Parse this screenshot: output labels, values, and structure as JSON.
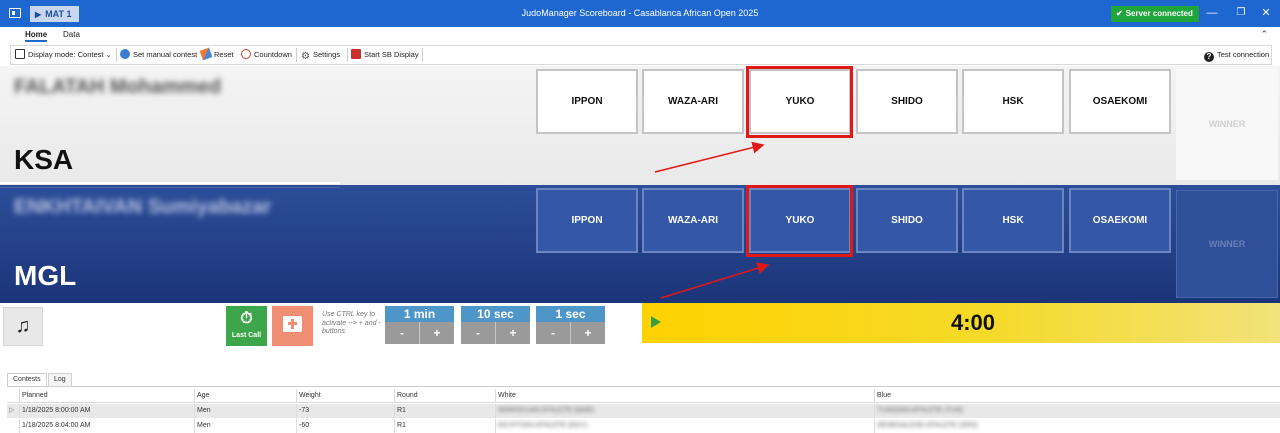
{
  "titlebar": {
    "mat_label": "MAT 1",
    "title": "JudoManager Scoreboard - Casablanca African Open 2025",
    "server_status": "Server connected"
  },
  "ribbon": {
    "tabs": [
      "Home",
      "Data"
    ],
    "toolbar": {
      "display_mode": "Display mode: Contest",
      "set_manual": "Set manual contest",
      "reset": "Reset",
      "countdown": "Countdown",
      "settings": "Settings",
      "start_sb": "Start SB Display",
      "test_connection": "Test connection"
    }
  },
  "white": {
    "name": "FALATAH Mohammed",
    "country": "KSA",
    "buttons": [
      "IPPON",
      "WAZA-ARI",
      "YUKO",
      "SHIDO",
      "HSK",
      "OSAEKOMI"
    ],
    "winner": "WINNER"
  },
  "blue": {
    "name": "ENKHTAIVAN Sumiyabazar",
    "country": "MGL",
    "buttons": [
      "IPPON",
      "WAZA-ARI",
      "YUKO",
      "SHIDO",
      "HSK",
      "OSAEKOMI"
    ],
    "winner": "WINNER"
  },
  "timer": {
    "last_call": "Last Call",
    "hint": "Use CTRL key to activate --> + and - buttons",
    "steps": [
      {
        "label": "1 min",
        "minus": "-",
        "plus": "+"
      },
      {
        "label": "10 sec",
        "minus": "-",
        "plus": "+"
      },
      {
        "label": "1 sec",
        "minus": "-",
        "plus": "+"
      }
    ],
    "clock": "4:00"
  },
  "contests": {
    "tabs": [
      "Contests",
      "Log"
    ],
    "columns": [
      "Planned",
      "Age",
      "Weight",
      "Round",
      "White",
      "Blue"
    ],
    "rows": [
      {
        "planned": "1/18/2025 8:00:00 AM",
        "age": "Men",
        "weight": "-73",
        "round": "R1",
        "white": "MOROCCAN ATHLETE (MAR)",
        "blue": "TUNISIAN ATHLETE (TUN)"
      },
      {
        "planned": "1/18/2025 8:04:00 AM",
        "age": "Men",
        "weight": "-60",
        "round": "R1",
        "white": "EGYPTIAN ATHLETE (EGY)",
        "blue": "SENEGALESE ATHLETE (SEN)"
      }
    ]
  },
  "colors": {
    "titlebar": "#1e66d0",
    "server": "#1fa53a",
    "blue_panel": "#2c4e9a",
    "highlight": "#e01818",
    "clock_bg": "#ffd200"
  }
}
